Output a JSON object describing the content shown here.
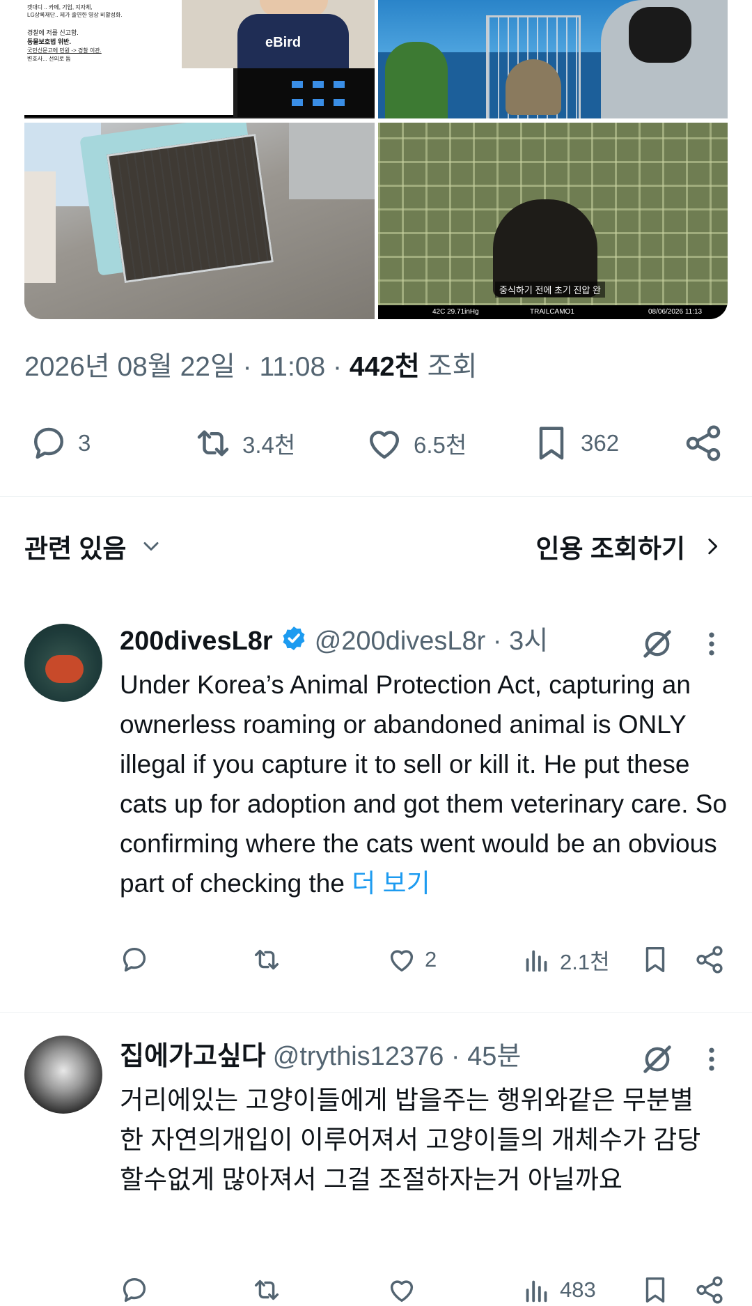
{
  "media": {
    "tile1_lines": [
      "캣대디 .. 카페, 기업, 지자체,",
      "LG상록재단.. 제가 출연한 영상 비활성화.",
      "경찰에 저를 신고함.",
      "동물보호법 위반.",
      "국민신문고에 민원 -> 경찰 이관.",
      "변호사... 선의로 돕"
    ],
    "shirt_text": "eBird",
    "caption": "중식하기 전에 초기 진압 완",
    "camera_bar": [
      "42C 29.71inHg",
      "TRAILCAMO1",
      "08/06/2026 11:13"
    ]
  },
  "post": {
    "date": "2026년 08월 22일 · 11:08 ·",
    "views": "442천",
    "views_label": "조회"
  },
  "actions": {
    "replies": "3",
    "reposts": "3.4천",
    "likes": "6.5천",
    "bookmarks": "362"
  },
  "section": {
    "related": "관련 있음",
    "quotes": "인용 조회하기"
  },
  "replies": [
    {
      "name": "200divesL8r",
      "verified": true,
      "handle": "@200divesL8r · 3시",
      "text": "Under Korea’s Animal Protection Act, capturing an ownerless roaming or abandoned animal is ONLY illegal if you capture it to sell or kill it. He put these cats up for adoption and got them veterinary care. So confirming where the cats went would be an obvious part of checking the",
      "more": "더 보기",
      "likes": "2",
      "views": "2.1천"
    },
    {
      "name": "집에가고싶다",
      "verified": false,
      "handle": "@trythis12376 · 45분",
      "text": "거리에있는 고양이들에게 밥을주는 행위와같은 무분별한 자연의개입이 이루어져서 고양이들의 개체수가 감당할수없게 많아져서 그걸 조절하자는거 아닐까요",
      "views": "483"
    }
  ],
  "colors": {
    "accent": "#1d9bf0",
    "muted": "#536471",
    "text": "#0f1419"
  }
}
